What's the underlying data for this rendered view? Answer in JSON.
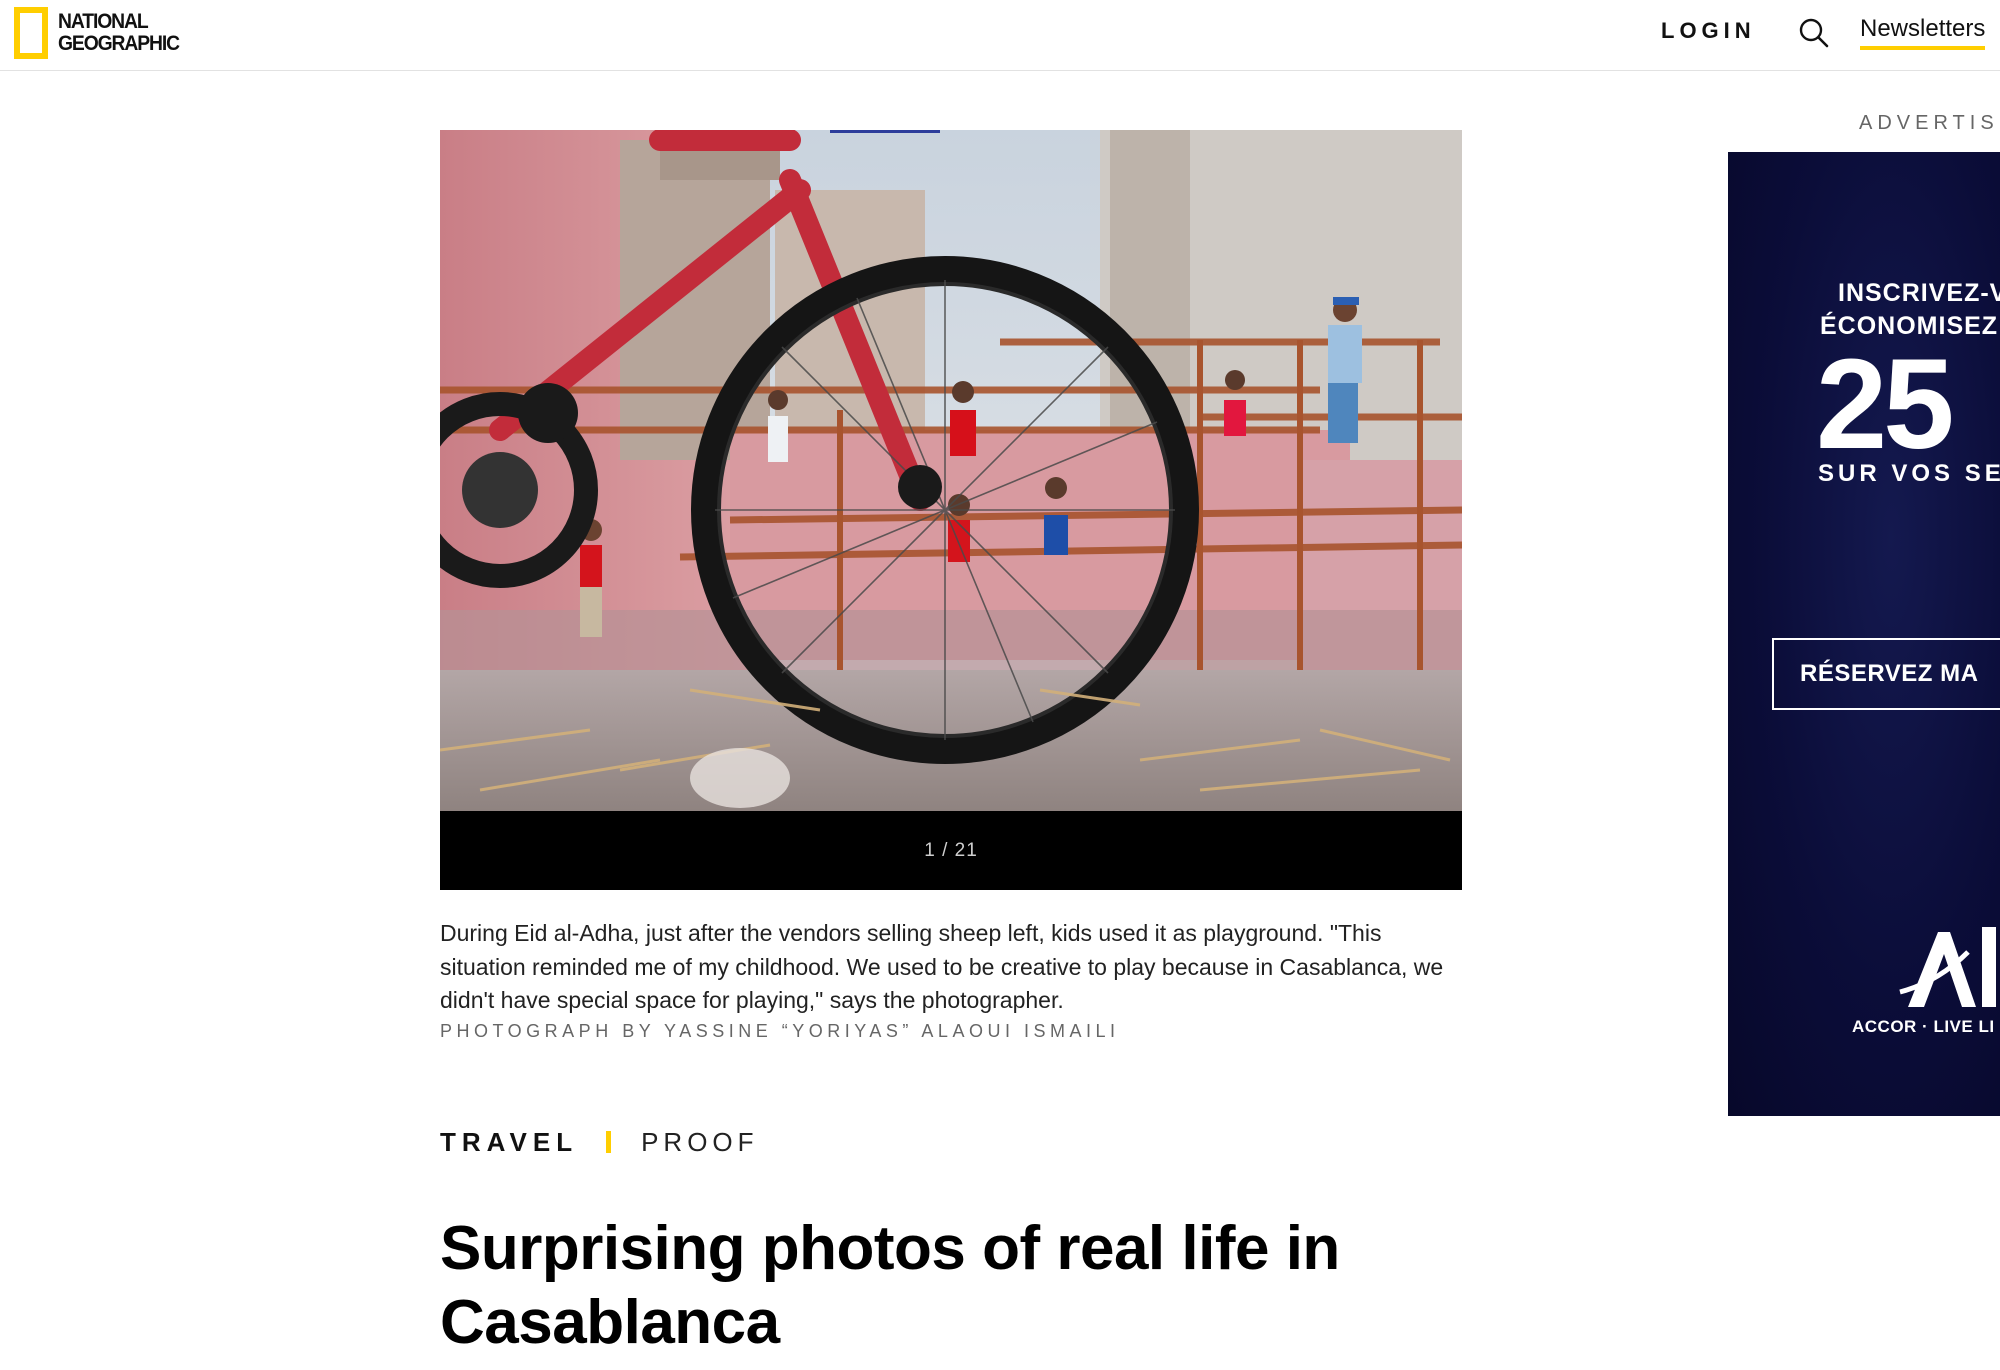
{
  "header": {
    "logo_line1": "NATIONAL",
    "logo_line2": "GEOGRAPHIC",
    "login_label": "LOGIN",
    "search_icon": "search-icon",
    "newsletters_label": "Newsletters"
  },
  "gallery": {
    "counter": "1 / 21",
    "photo_alt": "Children playing on scaffolding seen through a bicycle wheel in Casablanca",
    "caption": "During Eid al-Adha, just after the vendors selling sheep left, kids used it as playground. \"This situation reminded me of my childhood. We used to be creative to play because in Casablanca, we didn't have special space for playing,\" says the photographer.",
    "credit": "PHOTOGRAPH BY YASSINE “YORIYAS” ALAOUI ISMAILI"
  },
  "article": {
    "kicker_section": "TRAVEL",
    "kicker_series": "PROOF",
    "headline": "Surprising photos of real life in Casablanca"
  },
  "ad": {
    "label": "ADVERTISE",
    "line1": "INSCRIVEZ-V",
    "line2": "ÉCONOMISEZ",
    "big_text": "25",
    "line3": "SUR VOS SE",
    "cta_label": "RÉSERVEZ MA",
    "brand_line": "ACCOR · LIVE LI"
  },
  "colors": {
    "brand_yellow": "#ffce00",
    "ad_navy": "#0b0d39"
  }
}
